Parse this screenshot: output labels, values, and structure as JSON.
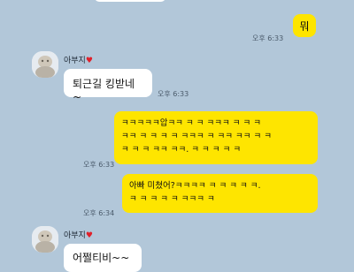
{
  "messages": [
    {
      "text": "",
      "time": ""
    },
    {
      "text": "뭐",
      "time": "오후 6:33"
    },
    {
      "sender": "아부지",
      "sender_icon": "heart-icon",
      "text": "퇴근길 킹받네~",
      "time": "오후 6:33"
    },
    {
      "text": "ㅋㅋㅋㅋㅋ압ㅋㅋ ㅋ ㅋ ㅋㅋㅋ ㅋ ㅋ ㅋ\nㅋㅋ ㅋ ㅋ ㅋ ㅋ ㅋㅋㅋ ㅋ ㅋㅋ ㅋㅋ ㅋ ㅋ\nㅋ ㅋ ㅋ ㅋㅋ ㅋㅋ. ㅋ ㅋ ㅋ ㅋ ㅋ",
      "time": "오후 6:33"
    },
    {
      "text": "아빠 미쳤어?ㅋㅋㅋㅋ ㅋ ㅋ ㅋ ㅋ ㅋ.\nㅋ ㅋ ㅋ ㅋ ㅋ ㅋㅋㅋ ㅋ",
      "time": "오후 6:34"
    },
    {
      "sender": "아부지",
      "sender_icon": "heart-icon",
      "text": "어쩔티비~~",
      "time": ""
    }
  ],
  "colors": {
    "background": "#b2c7d9",
    "sent_bubble": "#fee500",
    "received_bubble": "#ffffff",
    "heart": "#e0202a"
  }
}
